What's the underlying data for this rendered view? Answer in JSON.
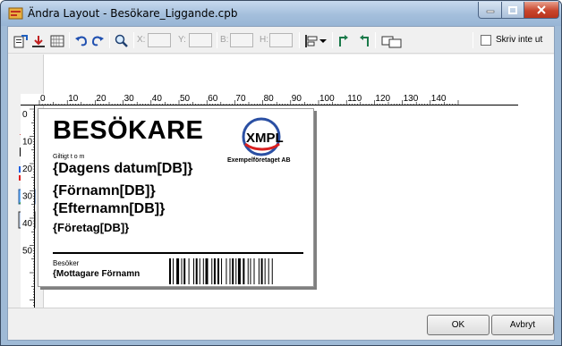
{
  "window": {
    "title": "Ändra Layout - Besökare_Liggande.cpb"
  },
  "toolbar": {
    "x_label": "X:",
    "y_label": "Y:",
    "b_label": "B:",
    "h_label": "H:",
    "x_value": "",
    "y_value": "",
    "b_value": "",
    "h_value": "",
    "no_print_label": "Skriv inte ut"
  },
  "rulers": {
    "top_ticks": [
      "0",
      "10",
      "20",
      "30",
      "40",
      "50",
      "60",
      "70",
      "80",
      "90",
      "100",
      "110",
      "120",
      "130",
      "140"
    ],
    "left_ticks": [
      "0",
      "10",
      "20",
      "30",
      "40",
      "50"
    ]
  },
  "label": {
    "title": "BESÖKARE",
    "valid_until": "Giltigt t o m",
    "date_field": "{Dagens datum[DB]}",
    "firstname_field": "{Förnamn[DB]}",
    "lastname_field": "{Efternamn[DB]}",
    "company_field": "{Företag[DB]}",
    "visitor_label": "Besöker",
    "recipient_field": "{Mottagare Förnamn",
    "logo_text": "XMPL",
    "logo_company": "Exempelföretaget AB"
  },
  "buttons": {
    "ok": "OK",
    "cancel": "Avbryt"
  },
  "colors": {
    "logo_blue": "#2a4fa3",
    "logo_red": "#d82020",
    "text_tool_red": "#cc1010"
  }
}
